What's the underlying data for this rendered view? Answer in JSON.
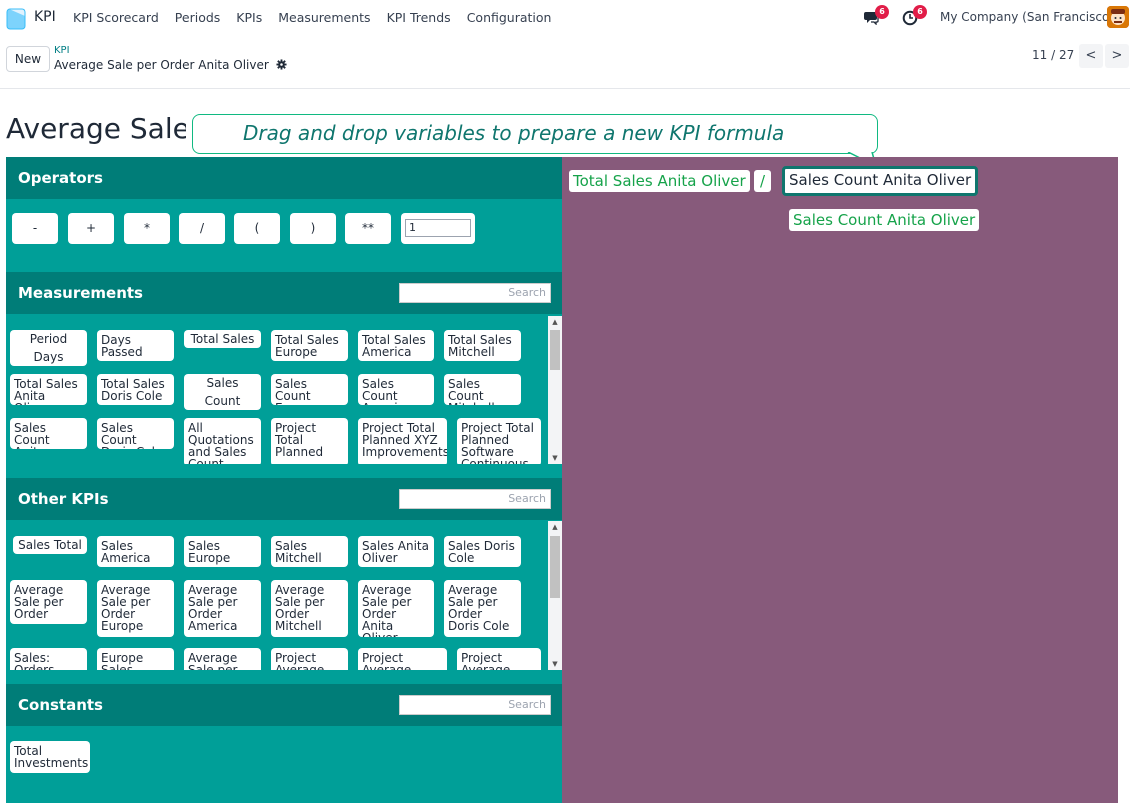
{
  "nav": {
    "app_name": "KPI",
    "menu": [
      "KPI Scorecard",
      "Periods",
      "KPIs",
      "Measurements",
      "KPI Trends",
      "Configuration"
    ],
    "messages_count": "6",
    "activities_count": "6",
    "company": "My Company (San Francisco)"
  },
  "control": {
    "new_label": "New",
    "breadcrumb_parent": "KPI",
    "breadcrumb_current": "Average Sale per Order Anita Oliver",
    "pager": "11 / 27",
    "prev": "<",
    "next": ">"
  },
  "page": {
    "title": "Average Sale per Order Anita Oliver",
    "tooltip": "Drag and drop variables to prepare a new KPI formula"
  },
  "operators": {
    "title": "Operators",
    "buttons": [
      "-",
      "+",
      "*",
      "/",
      "(",
      ")",
      "**"
    ],
    "value": "1"
  },
  "measurements": {
    "title": "Measurements",
    "search_placeholder": "Search",
    "items": [
      "Period Days",
      "Days Passed",
      "Total Sales",
      "Total Sales Europe",
      "Total Sales America",
      "Total Sales Mitchell",
      "Total Sales Anita Oliver",
      "Total Sales Doris Cole",
      "Sales Count",
      "Sales Count Europe",
      "Sales Count America",
      "Sales Count Mitchell",
      "Sales Count Anita Oliver",
      "Sales Count Doris Cole",
      "All Quotations and Sales Count",
      "Project Total Planned",
      "Project Total Planned XYZ Improvements",
      "Project Total Planned Software Continuous"
    ]
  },
  "other_kpis": {
    "title": "Other KPIs",
    "search_placeholder": "Search",
    "items": [
      "Sales Total",
      "Sales America",
      "Sales Europe",
      "Sales Mitchell",
      "Sales Anita Oliver",
      "Sales Doris Cole",
      "Average Sale per Order",
      "Average Sale per Order Europe",
      "Average Sale per Order America",
      "Average Sale per Order Mitchell",
      "Average Sale per Order Anita Oliver",
      "Average Sale per Order Doris Cole",
      "Sales: Orders",
      "Europe Sales Share",
      "Average Sale per",
      "Project Average",
      "Project Average Days",
      "Project Average Days"
    ]
  },
  "constants": {
    "title": "Constants",
    "search_placeholder": "Search",
    "items": [
      "Total Investments"
    ]
  },
  "formula": {
    "tokens": [
      "Total Sales Anita Oliver",
      "/",
      "Sales Count Anita Oliver"
    ],
    "dragging": "Sales Count Anita Oliver"
  },
  "colors": {
    "teal_panel": "#009f98",
    "teal_header": "#007d78",
    "purple_panel": "#875a7b",
    "chip_text_green": "#16a34a"
  }
}
